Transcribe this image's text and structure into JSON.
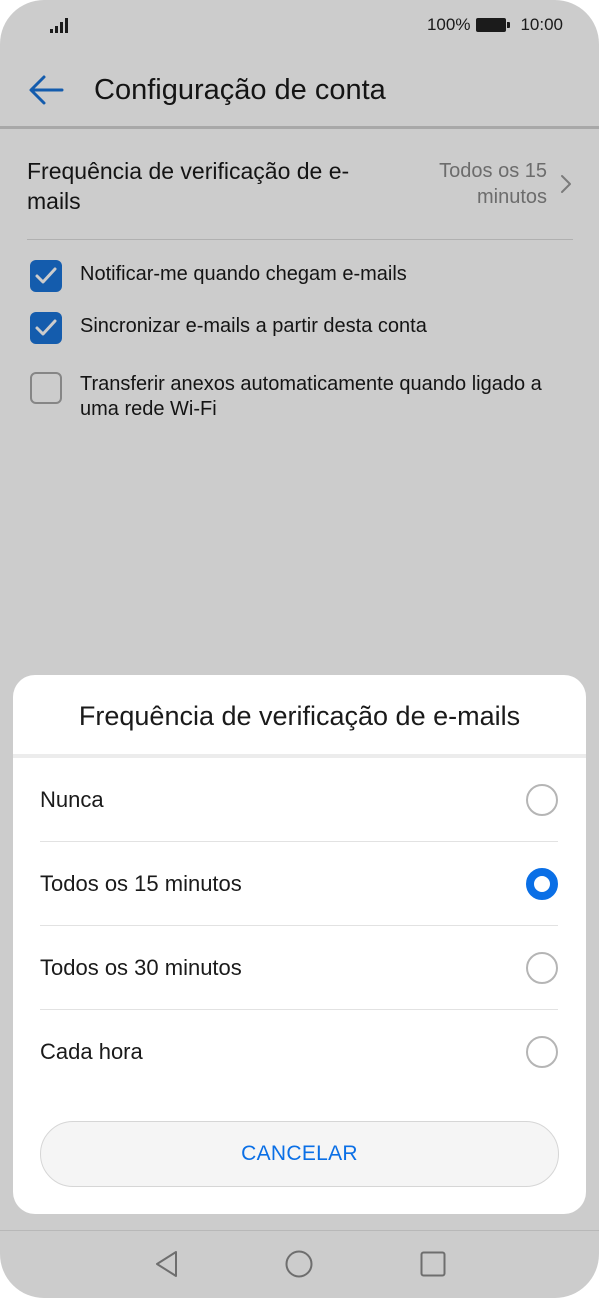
{
  "status_bar": {
    "battery_percent": "100%",
    "time": "10:00",
    "signal_icon": "signal-icon",
    "battery_icon": "battery-icon"
  },
  "app_bar": {
    "back_icon": "arrow-left-icon",
    "title": "Configuração de conta"
  },
  "settings": {
    "frequency": {
      "label": "Frequência de verificação de e-mails",
      "value": "Todos os 15 minutos"
    },
    "checkboxes": [
      {
        "label": "Notificar-me quando chegam e-mails",
        "checked": true
      },
      {
        "label": "Sincronizar e-mails a partir desta conta",
        "checked": true
      },
      {
        "label": "Transferir anexos automaticamente quando ligado a uma rede Wi-Fi",
        "checked": false
      }
    ]
  },
  "dialog": {
    "title": "Frequência de verificação de e-mails",
    "options": [
      {
        "label": "Nunca",
        "selected": false
      },
      {
        "label": "Todos os 15 minutos",
        "selected": true
      },
      {
        "label": "Todos os 30 minutos",
        "selected": false
      },
      {
        "label": "Cada hora",
        "selected": false
      }
    ],
    "cancel_label": "CANCELAR"
  },
  "nav_bar": {
    "icons": [
      "back-triangle-icon",
      "home-circle-icon",
      "recents-square-icon"
    ]
  },
  "colors": {
    "accent": "#0a6fe6",
    "checkbox": "#1a73d9",
    "scrim": "rgba(0,0,0,0.20)"
  }
}
